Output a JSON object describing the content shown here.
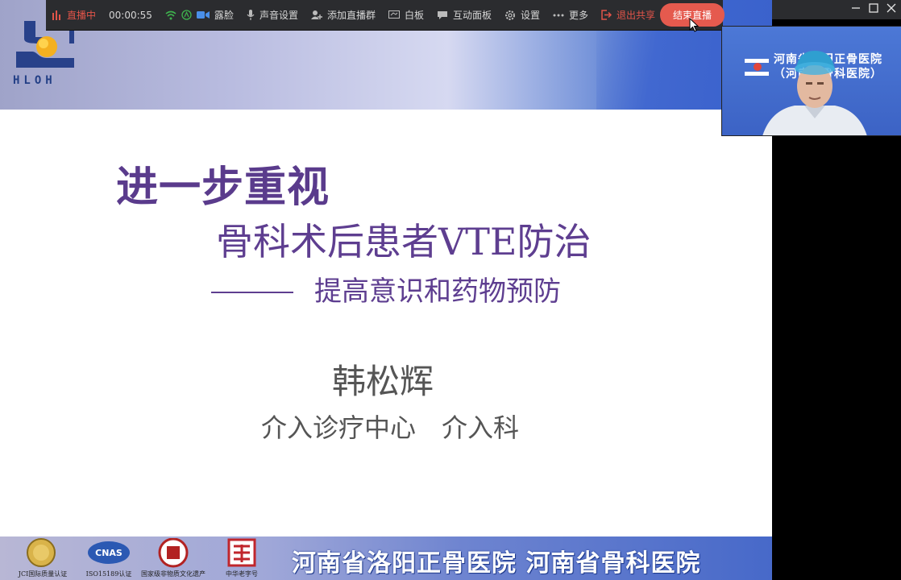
{
  "toolbar": {
    "live_label": "直播中",
    "timer": "00:00:55",
    "items": [
      {
        "label": "露脸"
      },
      {
        "label": "声音设置"
      },
      {
        "label": "添加直播群"
      },
      {
        "label": "白板"
      },
      {
        "label": "互动面板"
      },
      {
        "label": "设置"
      },
      {
        "label": "更多"
      }
    ],
    "exit_share": "退出共享",
    "end_live": "结束直播"
  },
  "slide": {
    "logo_text": "HLOH",
    "title_line1": "进一步重视",
    "title_line2": "骨科术后患者VTE防治",
    "title_line3": "提高意识和药物预防",
    "author": "韩松辉",
    "department": "介入诊疗中心　介入科",
    "footer_title": "河南省洛阳正骨医院 河南省骨科医院",
    "certifications": [
      {
        "label": "JCI国际质量认证"
      },
      {
        "label": "ISO15189认证"
      },
      {
        "label": "国家级非物质文化遗产"
      },
      {
        "label": "中华老字号"
      }
    ]
  },
  "camera": {
    "hospital_line1": "河南省洛阳正骨医院",
    "hospital_line2": "（河南省骨科医院）"
  },
  "colors": {
    "title_purple": "#5e3e90",
    "live_red": "#e25449",
    "end_button": "#e55a4e",
    "toolbar_bg": "#2b2c2f"
  }
}
